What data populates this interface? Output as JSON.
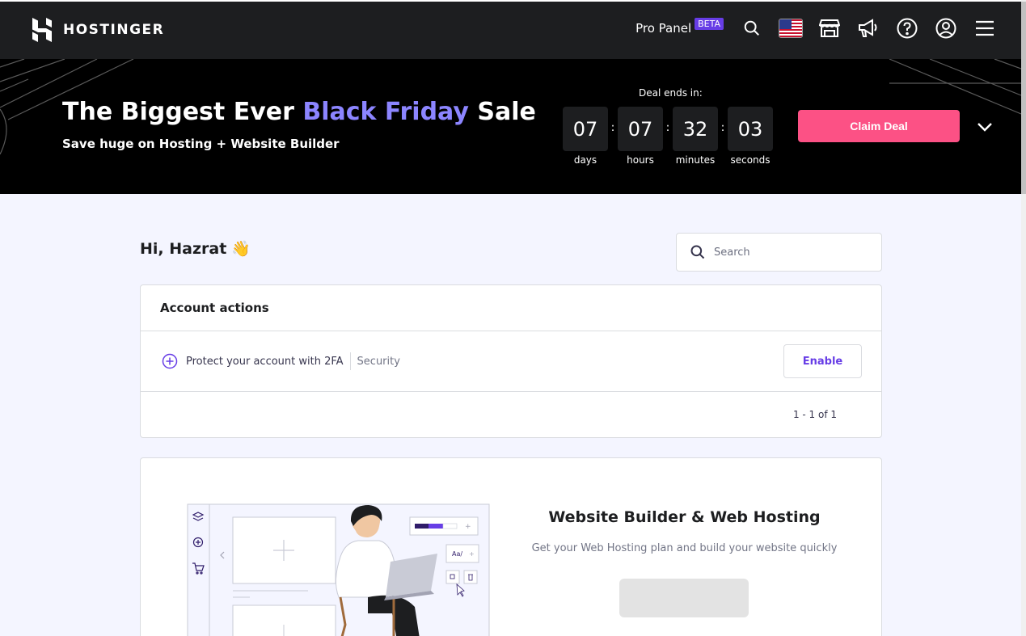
{
  "nav": {
    "logo_text": "HOSTINGER",
    "pro_panel": "Pro Panel",
    "beta": "BETA",
    "icons": [
      "search-icon",
      "flag-us-icon",
      "store-icon",
      "megaphone-icon",
      "help-icon",
      "account-icon",
      "menu-icon"
    ]
  },
  "banner": {
    "headline_pre": "The Biggest Ever ",
    "headline_accent": "Black Friday",
    "headline_post": " Sale",
    "subline": "Save huge on Hosting + Website Builder",
    "deal_label": "Deal ends in:",
    "countdown": [
      {
        "value": "07",
        "label": "days"
      },
      {
        "value": "07",
        "label": "hours"
      },
      {
        "value": "32",
        "label": "minutes"
      },
      {
        "value": "03",
        "label": "seconds"
      }
    ],
    "separator": ":",
    "claim_label": "Claim Deal"
  },
  "greeting": {
    "text": "Hi, Hazrat",
    "emoji": "👋"
  },
  "search": {
    "placeholder": "Search"
  },
  "account_actions": {
    "title": "Account actions",
    "item": {
      "text": "Protect your account with 2FA",
      "tag": "Security",
      "button": "Enable"
    },
    "pager": "1 - 1 of 1"
  },
  "promo": {
    "title": "Website Builder & Web Hosting",
    "subtitle": "Get your Web Hosting plan and build your website quickly",
    "illus_font_label": "Aa/"
  },
  "colors": {
    "accent": "#673de6",
    "banner_accent": "#8c85ff",
    "claim": "#fc5185",
    "nav_bg": "#1d1e20"
  }
}
